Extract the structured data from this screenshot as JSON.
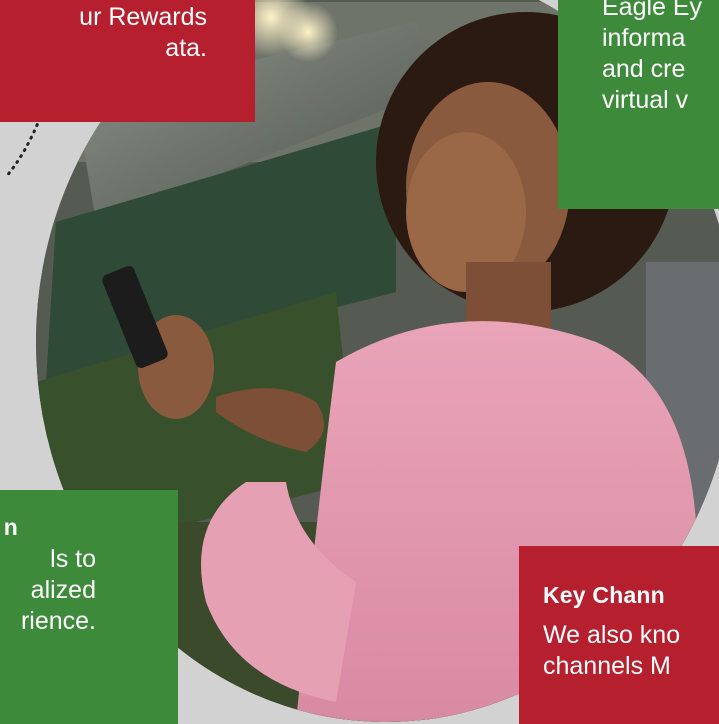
{
  "callouts": {
    "rewards": {
      "body": "ur Rewards\nata."
    },
    "eagle_eye": {
      "body": "Eagle Ey\ninforma\nand cre\nvirtual v"
    },
    "personalization": {
      "title": "n",
      "body": "ls to\nalized\nrience."
    },
    "key_channels": {
      "title": "Key Chann",
      "body": "We also kno\nchannels M"
    }
  },
  "colors": {
    "red": "#b51f2e",
    "green": "#3d8a3a",
    "background": "#d2d2d2"
  },
  "image": {
    "subject": "woman-using-smartphone-in-grocery-store"
  }
}
